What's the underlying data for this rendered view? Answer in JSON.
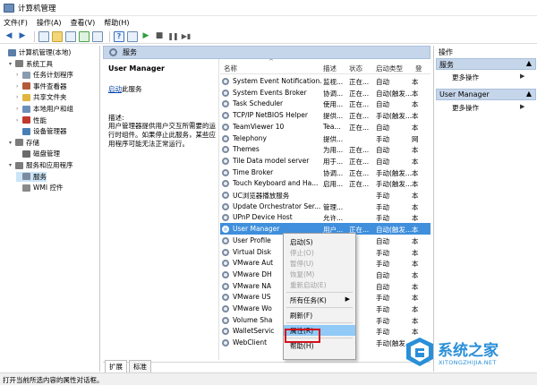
{
  "window": {
    "title": "计算机管理"
  },
  "menubar": [
    "文件(F)",
    "操作(A)",
    "查看(V)",
    "帮助(H)"
  ],
  "tree": [
    {
      "label": "计算机管理(本地)",
      "level": 0,
      "twisty": "",
      "icon": "computer-management-icon",
      "color": "#5b7fa8"
    },
    {
      "label": "系统工具",
      "level": 1,
      "twisty": "▾",
      "icon": "system-tools-icon",
      "color": "#7c7c7c"
    },
    {
      "label": "任务计划程序",
      "level": 2,
      "twisty": "›",
      "icon": "task-scheduler-icon",
      "color": "#8a9cb0"
    },
    {
      "label": "事件查看器",
      "level": 2,
      "twisty": "›",
      "icon": "event-viewer-icon",
      "color": "#b35a3a"
    },
    {
      "label": "共享文件夹",
      "level": 2,
      "twisty": "›",
      "icon": "shared-folder-icon",
      "color": "#e0b640"
    },
    {
      "label": "本地用户和组",
      "level": 2,
      "twisty": "›",
      "icon": "users-icon",
      "color": "#6b8fb8"
    },
    {
      "label": "性能",
      "level": 2,
      "twisty": "›",
      "icon": "performance-icon",
      "color": "#c0392b"
    },
    {
      "label": "设备管理器",
      "level": 2,
      "twisty": "",
      "icon": "device-manager-icon",
      "color": "#4a7fb5"
    },
    {
      "label": "存储",
      "level": 1,
      "twisty": "▾",
      "icon": "storage-icon",
      "color": "#7c7c7c"
    },
    {
      "label": "磁盘管理",
      "level": 2,
      "twisty": "",
      "icon": "disk-management-icon",
      "color": "#6a6a6a"
    },
    {
      "label": "服务和应用程序",
      "level": 1,
      "twisty": "▾",
      "icon": "services-apps-icon",
      "color": "#7c7c7c"
    },
    {
      "label": "服务",
      "level": 2,
      "twisty": "",
      "icon": "services-icon",
      "color": "#7c8ba0",
      "selected": true
    },
    {
      "label": "WMI 控件",
      "level": 2,
      "twisty": "",
      "icon": "wmi-control-icon",
      "color": "#8a8a8a"
    }
  ],
  "panel_title": "服务",
  "detail": {
    "name": "User Manager",
    "start_link": "启动",
    "start_suffix": "此服务",
    "desc_label": "描述:",
    "desc_text": "用户管理器提供用户交互所需要的运行时组件。如果停止此服务，某些应用程序可能无法正常运行。"
  },
  "columns": [
    "名称",
    "描述",
    "状态",
    "启动类型",
    "登"
  ],
  "services": [
    {
      "name": "System Event Notification...",
      "desc": "监视...",
      "status": "正在...",
      "start": "自动",
      "logon": "本"
    },
    {
      "name": "System Events Broker",
      "desc": "协调...",
      "status": "正在...",
      "start": "自动(触发...",
      "logon": "本"
    },
    {
      "name": "Task Scheduler",
      "desc": "使用...",
      "status": "正在...",
      "start": "自动",
      "logon": "本"
    },
    {
      "name": "TCP/IP NetBIOS Helper",
      "desc": "提供...",
      "status": "正在...",
      "start": "手动(触发...",
      "logon": "本"
    },
    {
      "name": "TeamViewer 10",
      "desc": "Tea...",
      "status": "正在...",
      "start": "自动",
      "logon": "本"
    },
    {
      "name": "Telephony",
      "desc": "提供...",
      "status": "",
      "start": "手动",
      "logon": "网"
    },
    {
      "name": "Themes",
      "desc": "为用...",
      "status": "正在...",
      "start": "自动",
      "logon": "本"
    },
    {
      "name": "Tile Data model server",
      "desc": "用于...",
      "status": "正在...",
      "start": "自动",
      "logon": "本"
    },
    {
      "name": "Time Broker",
      "desc": "协调...",
      "status": "正在...",
      "start": "手动(触发...",
      "logon": "本"
    },
    {
      "name": "Touch Keyboard and Ha...",
      "desc": "启用...",
      "status": "正在...",
      "start": "手动(触发...",
      "logon": "本"
    },
    {
      "name": "UC浏览器播放服务",
      "desc": "",
      "status": "",
      "start": "手动",
      "logon": "本"
    },
    {
      "name": "Update Orchestrator Ser...",
      "desc": "管理...",
      "status": "",
      "start": "手动",
      "logon": "本"
    },
    {
      "name": "UPnP Device Host",
      "desc": "允许...",
      "status": "",
      "start": "手动",
      "logon": "本"
    },
    {
      "name": "User Manager",
      "desc": "用户...",
      "status": "正在...",
      "start": "自动(触发...",
      "logon": "本",
      "selected": true
    },
    {
      "name": "User Profile",
      "desc": "",
      "status": "",
      "start": "自动",
      "logon": "本"
    },
    {
      "name": "Virtual Disk",
      "desc": "",
      "status": "",
      "start": "手动",
      "logon": "本"
    },
    {
      "name": "VMware Aut",
      "desc": "",
      "status": "",
      "start": "手动",
      "logon": "本"
    },
    {
      "name": "VMware DH",
      "desc": "",
      "status": "",
      "start": "自动",
      "logon": "本"
    },
    {
      "name": "VMware NA",
      "desc": "",
      "status": "",
      "start": "自动",
      "logon": "本"
    },
    {
      "name": "VMware US",
      "desc": "",
      "status": "",
      "start": "手动",
      "logon": "本"
    },
    {
      "name": "VMware Wo",
      "desc": "",
      "status": "",
      "start": "手动",
      "logon": "本"
    },
    {
      "name": "Volume Sha",
      "desc": "",
      "status": "",
      "start": "手动",
      "logon": "本"
    },
    {
      "name": "WalletServic",
      "desc": "",
      "status": "",
      "start": "手动",
      "logon": "本"
    },
    {
      "name": "WebClient",
      "desc": "",
      "status": "",
      "start": "手动(触发...",
      "logon": "本"
    }
  ],
  "context_menu": [
    {
      "label": "启动(S)",
      "disabled": false
    },
    {
      "label": "停止(O)",
      "disabled": true
    },
    {
      "label": "暂停(U)",
      "disabled": true
    },
    {
      "label": "恢复(M)",
      "disabled": true
    },
    {
      "label": "重新启动(E)",
      "disabled": true
    },
    {
      "sep": true
    },
    {
      "label": "所有任务(K)",
      "submenu": true
    },
    {
      "sep": true
    },
    {
      "label": "刷新(F)"
    },
    {
      "sep": true
    },
    {
      "label": "属性(R)",
      "highlight": true
    },
    {
      "sep": true
    },
    {
      "label": "帮助(H)"
    }
  ],
  "actions": {
    "title": "操作",
    "sections": [
      {
        "label": "服务",
        "items": [
          "更多操作"
        ]
      },
      {
        "label": "User Manager",
        "items": [
          "更多操作"
        ]
      }
    ]
  },
  "tabs": [
    "扩展",
    "标准"
  ],
  "statusbar": "打开当前所选内容的属性对话框。",
  "watermark": {
    "text": "系统之家",
    "url": "XITONGZHIJIA.NET",
    "color": "#2a8fd8"
  }
}
